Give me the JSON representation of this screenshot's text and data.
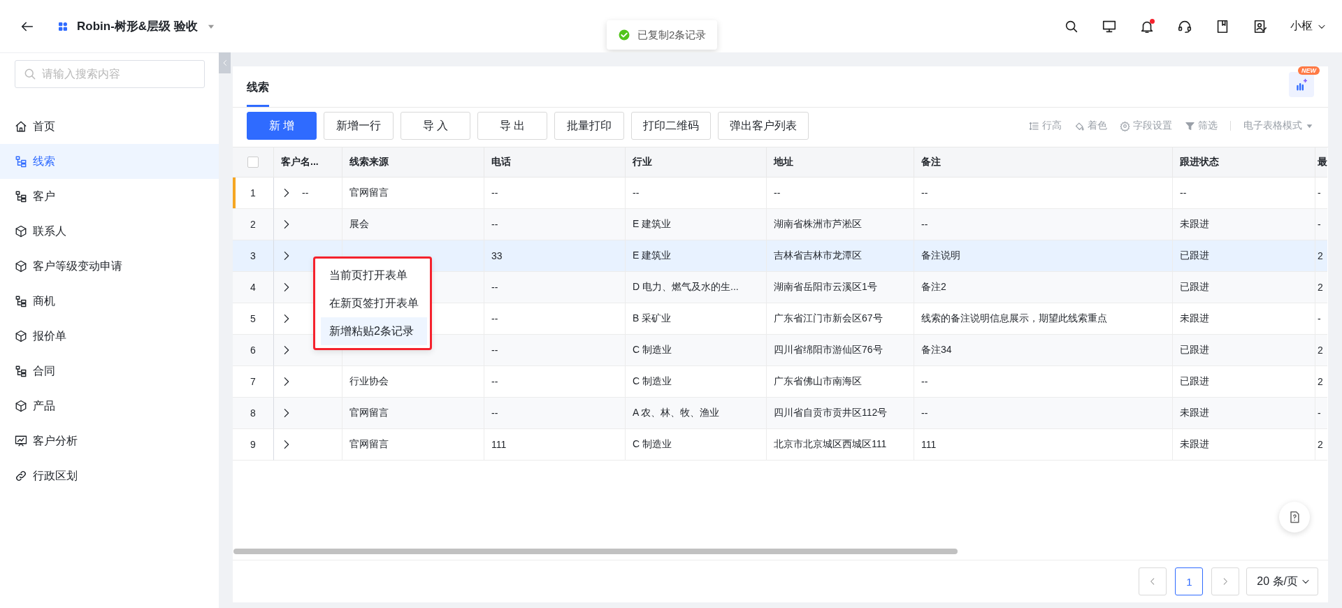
{
  "header": {
    "title": "Robin-树形&层级 验收",
    "user": "小枢",
    "notification_dot": true
  },
  "toast": {
    "message": "已复制2条记录"
  },
  "sidebar": {
    "search": {
      "placeholder": "请输入搜索内容"
    },
    "items": [
      {
        "label": "首页",
        "kind": "home",
        "selected": false
      },
      {
        "label": "线索",
        "kind": "tree",
        "selected": true
      },
      {
        "label": "客户",
        "kind": "tree",
        "selected": false
      },
      {
        "label": "联系人",
        "kind": "cube",
        "selected": false
      },
      {
        "label": "客户等级变动申请",
        "kind": "cube",
        "selected": false
      },
      {
        "label": "商机",
        "kind": "tree",
        "selected": false
      },
      {
        "label": "报价单",
        "kind": "cube",
        "selected": false
      },
      {
        "label": "合同",
        "kind": "tree",
        "selected": false
      },
      {
        "label": "产品",
        "kind": "cube",
        "selected": false
      },
      {
        "label": "客户分析",
        "kind": "chart",
        "selected": false
      },
      {
        "label": "行政区划",
        "kind": "link",
        "selected": false
      }
    ]
  },
  "tabs": [
    {
      "label": "线索",
      "selected": true
    }
  ],
  "new_badge": "NEW",
  "toolbar": {
    "buttons": [
      {
        "label": "新 增",
        "kind": "primary"
      },
      {
        "label": "新增一行",
        "kind": "default"
      },
      {
        "label": "导 入",
        "kind": "default"
      },
      {
        "label": "导 出",
        "kind": "default"
      },
      {
        "label": "批量打印",
        "kind": "default"
      },
      {
        "label": "打印二维码",
        "kind": "default"
      },
      {
        "label": "弹出客户列表",
        "kind": "default"
      }
    ],
    "tools": [
      {
        "label": "行高",
        "kind": "row-height"
      },
      {
        "label": "着色",
        "kind": "paint"
      },
      {
        "label": "字段设置",
        "kind": "gear"
      },
      {
        "label": "筛选",
        "kind": "filter"
      }
    ],
    "mode_select": "电子表格模式"
  },
  "table": {
    "all_checked": false,
    "columns": [
      "客户名...",
      "线索来源",
      "电话",
      "行业",
      "地址",
      "备注",
      "跟进状态",
      "最"
    ],
    "rows": [
      {
        "no": "1",
        "current": true,
        "selected": false,
        "expanded": false,
        "name": "--",
        "source": "官网留言",
        "phone": "--",
        "industry": "--",
        "address": "--",
        "note": "--",
        "status": "--",
        "column_9": "-"
      },
      {
        "no": "2",
        "current": false,
        "selected": false,
        "expanded": false,
        "source": "展会",
        "phone": "--",
        "industry": "E 建筑业",
        "address": "湖南省株洲市芦淞区",
        "note": "--",
        "status": "未跟进",
        "column_9": "-"
      },
      {
        "no": "3",
        "current": false,
        "selected": true,
        "expanded": false,
        "phone": "33",
        "industry": "E 建筑业",
        "address": "吉林省吉林市龙潭区",
        "note": "备注说明",
        "status": "已跟进",
        "column_9": "2"
      },
      {
        "no": "4",
        "current": false,
        "selected": false,
        "expanded": false,
        "phone": "--",
        "industry": "D 电力、燃气及水的生...",
        "address": "湖南省岳阳市云溪区1号",
        "note": "备注2",
        "status": "已跟进",
        "column_9": "2"
      },
      {
        "no": "5",
        "current": false,
        "selected": false,
        "expanded": false,
        "phone": "--",
        "industry": "B 采矿业",
        "address": "广东省江门市新会区67号",
        "note": "线索的备注说明信息展示，期望此线索重点",
        "status": "未跟进",
        "column_9": "-"
      },
      {
        "no": "6",
        "current": false,
        "selected": false,
        "expanded": false,
        "phone": "--",
        "industry": "C 制造业",
        "address": "四川省绵阳市游仙区76号",
        "note": "备注34",
        "status": "已跟进",
        "column_9": "2"
      },
      {
        "no": "7",
        "current": false,
        "selected": false,
        "expanded": false,
        "source": "行业协会",
        "phone": "--",
        "industry": "C 制造业",
        "address": "广东省佛山市南海区",
        "note": "--",
        "status": "已跟进",
        "column_9": "2"
      },
      {
        "no": "8",
        "current": false,
        "selected": false,
        "expanded": false,
        "source": "官网留言",
        "phone": "--",
        "industry": "A 农、林、牧、渔业",
        "address": "四川省自贡市贡井区112号",
        "note": "--",
        "status": "未跟进",
        "column_9": "-"
      },
      {
        "no": "9",
        "current": false,
        "selected": false,
        "expanded": false,
        "source": "官网留言",
        "phone": "111",
        "industry": "C 制造业",
        "address": "北京市北京城区西城区111",
        "note": "111",
        "status": "未跟进",
        "column_9": "2"
      }
    ]
  },
  "context_menu": {
    "items": [
      {
        "label": "当前页打开表单",
        "hovered": false
      },
      {
        "label": "在新页签打开表单",
        "hovered": false
      },
      {
        "label": "新增粘贴2条记录",
        "hovered": true
      }
    ]
  },
  "pagination": {
    "pages": [
      {
        "label": "1",
        "selected": true
      }
    ],
    "page_size": "20 条/页"
  }
}
